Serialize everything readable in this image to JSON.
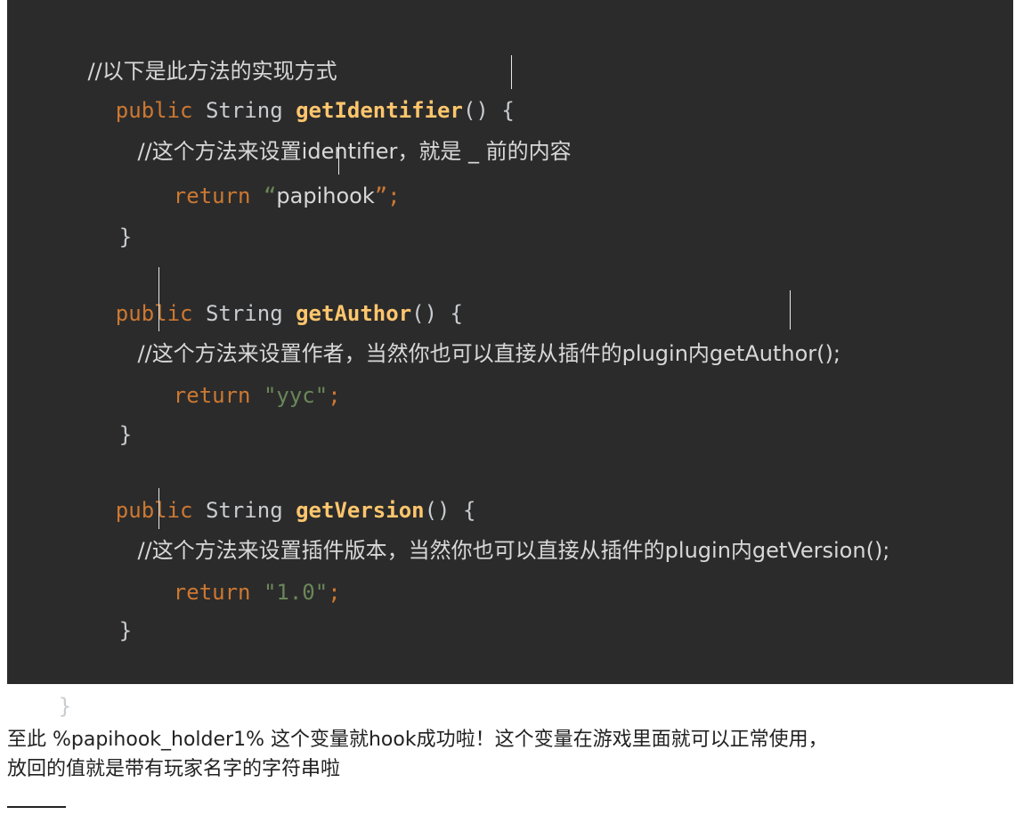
{
  "code": {
    "lines": [
      {
        "comment": "//以下是此方法的实现方式"
      },
      {
        "kw": "public",
        "type": "String",
        "fn": "getIdentifier",
        "paren": "()",
        "brace": "{"
      },
      {
        "comment": "//这个方法来设置identifier，就是 _ 前的内容"
      },
      {
        "kw": "return",
        "open": "“",
        "text": "papihook",
        "close": "”;"
      },
      {
        "brace": "}"
      },
      {
        "kw": "public",
        "type": "String",
        "fn": "getAuthor",
        "paren": "()",
        "brace": "{"
      },
      {
        "comment": "//这个方法来设置作者，当然你也可以直接从插件的plugin内getAuthor();"
      },
      {
        "kw": "return",
        "str": "\"yyc\"",
        "semi": ";"
      },
      {
        "brace": "}"
      },
      {
        "kw": "public",
        "type": "String",
        "fn": "getVersion",
        "paren": "()",
        "brace": "{"
      },
      {
        "comment": "//这个方法来设置插件版本，当然你也可以直接从插件的plugin内getVersion();"
      },
      {
        "kw": "return",
        "str": "\"1.0\"",
        "semi": ";"
      },
      {
        "brace": "}"
      },
      {
        "brace": "}"
      }
    ]
  },
  "prose": {
    "line1": "至此 %papihook_holder1% 这个变量就hook成功啦！这个变量在游戏里面就可以正常使用，",
    "line2": "放回的值就是带有玩家名字的字符串啦"
  }
}
